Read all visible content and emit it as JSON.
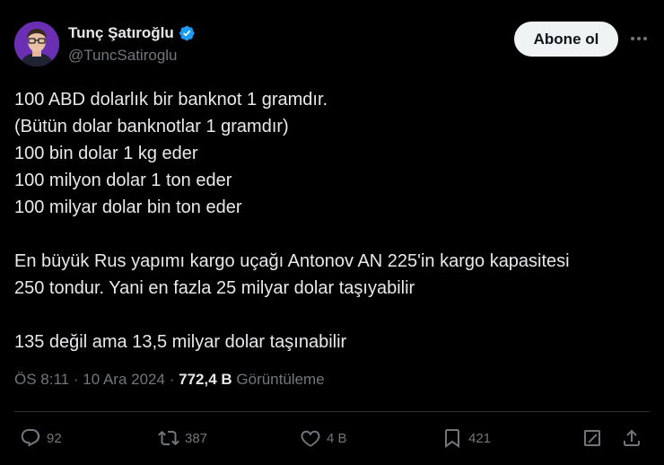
{
  "author": {
    "name": "Tunç Şatıroğlu",
    "handle": "@TuncSatiroglu",
    "verified": true
  },
  "follow_label": "Abone ol",
  "more_icon": "more-horizontal-icon",
  "text_lines": [
    "100 ABD dolarlık bir banknot 1 gramdır.",
    "(Bütün dolar banknotlar 1 gramdır)",
    "100 bin dolar 1 kg eder",
    "100 milyon dolar 1 ton eder",
    "100 milyar dolar bin ton eder",
    "",
    "En büyük Rus yapımı kargo uçağı Antonov AN 225'in kargo kapasitesi",
    "250 tondur. Yani en fazla 25 milyar dolar taşıyabilir",
    "",
    "135 değil ama 13,5 milyar dolar taşınabilir"
  ],
  "meta": {
    "time": "ÖS 8:11",
    "separator": "·",
    "date": "10 Ara 2024",
    "views_count": "772,4 B",
    "views_label": "Görüntüleme"
  },
  "actions": {
    "replies": "92",
    "reposts": "387",
    "likes": "4 B",
    "bookmarks": "421"
  },
  "colors": {
    "background": "#000000",
    "text": "#e7e9ea",
    "secondary": "#71767b",
    "verified": "#1d9bf0",
    "button_bg": "#eff3f4"
  }
}
